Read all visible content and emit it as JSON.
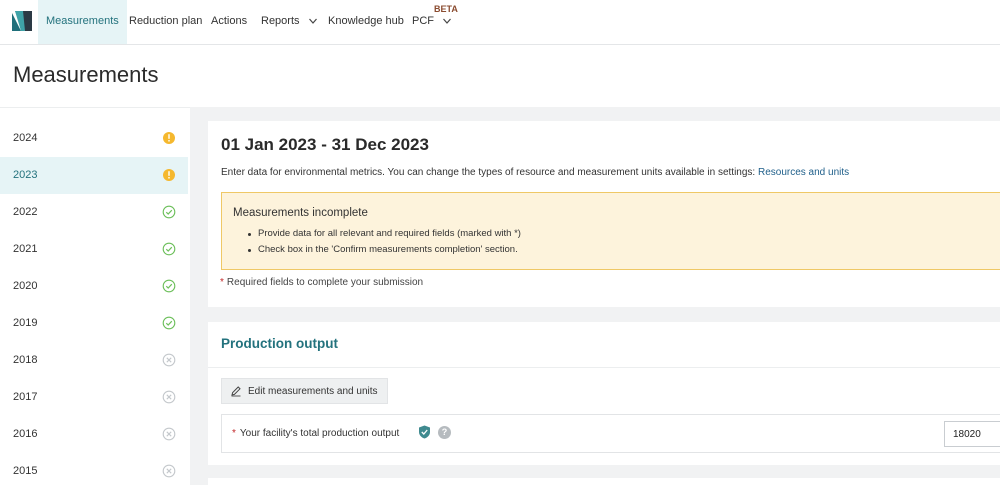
{
  "nav": {
    "items": [
      {
        "label": "Measurements",
        "active": true
      },
      {
        "label": "Reduction plan"
      },
      {
        "label": "Actions"
      },
      {
        "label": "Reports"
      },
      {
        "label": "Knowledge hub"
      },
      {
        "label": "PCF"
      }
    ],
    "beta_badge": "BETA"
  },
  "page_title": "Measurements",
  "years": [
    {
      "label": "2024",
      "status": "incomplete",
      "status_icon": "warning-icon"
    },
    {
      "label": "2023",
      "status": "incomplete",
      "status_icon": "warning-icon",
      "selected": true
    },
    {
      "label": "2022",
      "status": "complete",
      "status_icon": "check-circle-icon"
    },
    {
      "label": "2021",
      "status": "complete",
      "status_icon": "check-circle-icon"
    },
    {
      "label": "2020",
      "status": "complete",
      "status_icon": "check-circle-icon"
    },
    {
      "label": "2019",
      "status": "complete",
      "status_icon": "check-circle-icon"
    },
    {
      "label": "2018",
      "status": "not-started",
      "status_icon": "x-circle-icon"
    },
    {
      "label": "2017",
      "status": "not-started",
      "status_icon": "x-circle-icon"
    },
    {
      "label": "2016",
      "status": "not-started",
      "status_icon": "x-circle-icon"
    },
    {
      "label": "2015",
      "status": "not-started",
      "status_icon": "x-circle-icon"
    }
  ],
  "period": {
    "title": "01 Jan 2023 - 31 Dec 2023",
    "intro": "Enter data for environmental metrics. You can change the types of resource and measurement units available in settings:",
    "settings_link": "Resources and units"
  },
  "warning": {
    "title": "Measurements incomplete",
    "items": [
      "Provide data for all relevant and required fields (marked with *)",
      "Check box in the 'Confirm measurements completion' section."
    ]
  },
  "required_note": "Required fields to complete your submission",
  "production": {
    "title": "Production output",
    "edit_label": "Edit measurements and units",
    "field_label": "Your facility's total production output",
    "field_value": "18020",
    "help_glyph": "?"
  },
  "colors": {
    "accent": "#23727d",
    "warning": "#f5b82e",
    "complete": "#6cbf5a",
    "neutral_icon": "#c4c8cc"
  }
}
